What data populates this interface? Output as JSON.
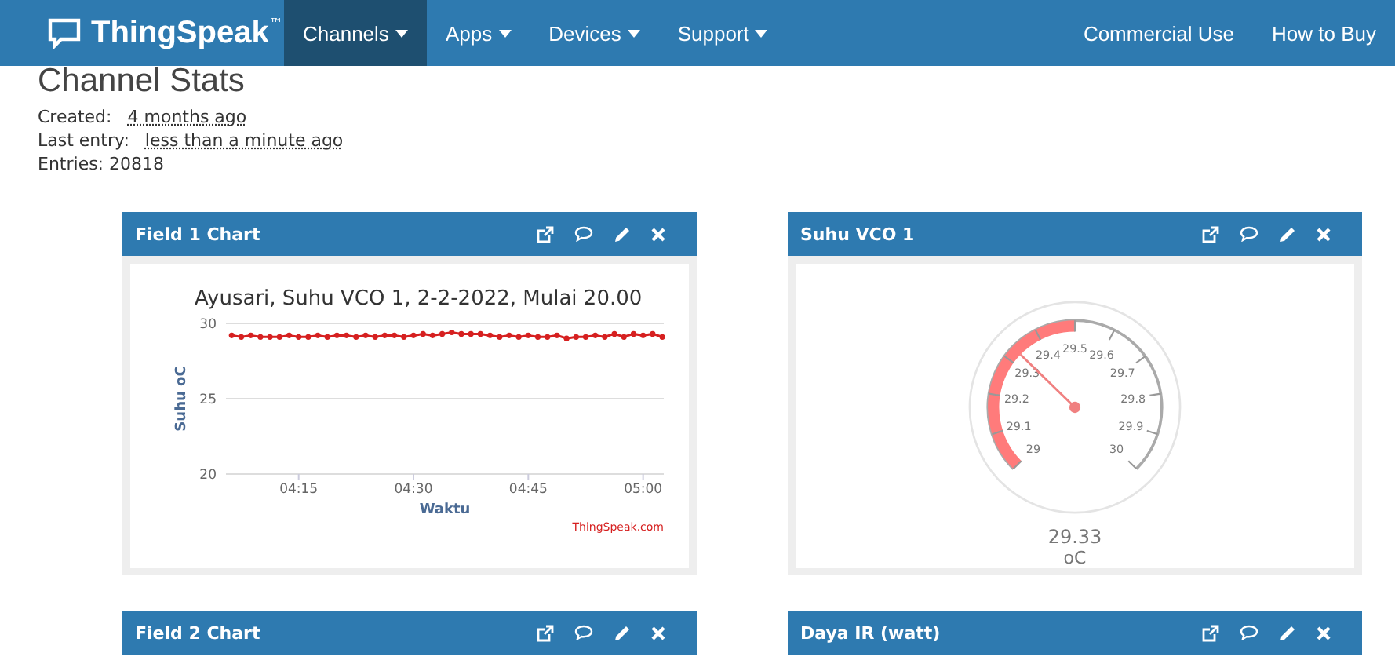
{
  "navbar": {
    "brand": "ThingSpeak",
    "trademark": "™",
    "items": [
      {
        "label": "Channels",
        "selected": true
      },
      {
        "label": "Apps",
        "selected": false
      },
      {
        "label": "Devices",
        "selected": false
      },
      {
        "label": "Support",
        "selected": false
      }
    ],
    "right_items": [
      "Commercial Use",
      "How to Buy"
    ]
  },
  "heading": "Channel Stats",
  "stats": [
    {
      "label": "Created:",
      "value": "4 months ago"
    },
    {
      "label": "Last entry:",
      "value": "less than a minute ago"
    },
    {
      "label": "Entries: 20818"
    }
  ],
  "cards": [
    {
      "title": "Field 1 Chart",
      "kind": "chart",
      "chart_data": {
        "type": "line",
        "title": "Ayusari, Suhu VCO 1, 2-2-2022, Mulai 20.00",
        "xlabel": "Waktu",
        "ylabel": "Suhu oC",
        "ylim": [
          20,
          30
        ],
        "yticks": [
          20,
          25,
          30
        ],
        "categories": [
          null,
          null,
          null,
          null,
          null,
          null,
          null,
          "04:15",
          null,
          null,
          null,
          null,
          null,
          null,
          null,
          null,
          null,
          null,
          null,
          "04:30",
          null,
          null,
          null,
          null,
          null,
          null,
          null,
          null,
          null,
          null,
          null,
          "04:45",
          null,
          null,
          null,
          null,
          null,
          null,
          null,
          null,
          null,
          null,
          null,
          "05:00",
          null,
          null
        ],
        "series": [
          {
            "color": "#d62020",
            "marker": "circle",
            "values": [
              29.2,
              29.1,
              29.2,
              29.1,
              29.1,
              29.1,
              29.2,
              29.1,
              29.1,
              29.2,
              29.1,
              29.2,
              29.2,
              29.1,
              29.2,
              29.1,
              29.2,
              29.2,
              29.1,
              29.2,
              29.3,
              29.2,
              29.3,
              29.4,
              29.3,
              29.3,
              29.3,
              29.2,
              29.1,
              29.2,
              29.1,
              29.2,
              29.1,
              29.1,
              29.2,
              29.0,
              29.1,
              29.1,
              29.2,
              29.1,
              29.3,
              29.1,
              29.3,
              29.2,
              29.3,
              29.1
            ]
          }
        ]
      },
      "credit": "ThingSpeak.com"
    },
    {
      "title": "Suhu VCO 1",
      "kind": "gauge",
      "gauge": {
        "ticks": [
          "29",
          "29.1",
          "29.2",
          "29.3",
          "29.4",
          "29.5",
          "29.6",
          "29.7",
          "29.8",
          "29.9",
          "30"
        ],
        "value": "29.33",
        "unit": "oC"
      }
    },
    {
      "title": "Field 2 Chart",
      "kind": "chart"
    },
    {
      "title": "Daya IR (watt)",
      "kind": "chart"
    }
  ]
}
